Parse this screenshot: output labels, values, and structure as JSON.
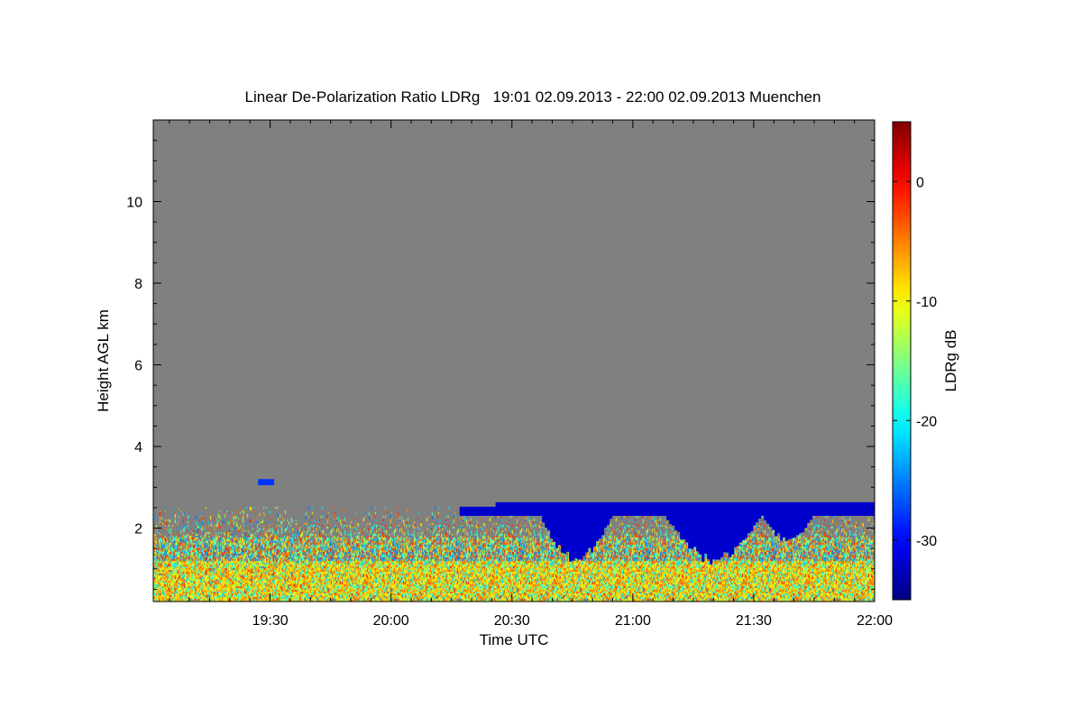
{
  "chart_data": {
    "type": "heatmap",
    "title": "Linear De-Polarization Ratio LDRg   19:01 02.09.2013 - 22:00 02.09.2013 Muenchen",
    "xlabel": "Time UTC",
    "ylabel": "Height AGL km",
    "colorbar_label": "LDRg dB",
    "x_unit": "UTC time",
    "xlim": [
      "19:01",
      "22:00"
    ],
    "ylim": [
      0.2,
      12.0
    ],
    "x_ticks": [
      "19:30",
      "20:00",
      "20:30",
      "21:00",
      "21:30",
      "22:00"
    ],
    "y_ticks": [
      2,
      4,
      6,
      8,
      10
    ],
    "colorbar_ticks": [
      0,
      -10,
      -20,
      -30
    ],
    "colorbar_range": [
      -35,
      5
    ],
    "colormap": "jet",
    "no_data_color": "#808080",
    "features": [
      {
        "name": "noisy aerosol boundary layer",
        "time_range": [
          "19:01",
          "22:00"
        ],
        "height_km": [
          0.2,
          2.5
        ],
        "ldr_db_range": [
          -25,
          0
        ]
      },
      {
        "name": "thin aerosol layer",
        "time_range": [
          "19:27",
          "19:31"
        ],
        "height_km": [
          3.05,
          3.2
        ],
        "ldr_db": -28
      },
      {
        "name": "low depolarization cloud layer with virga",
        "time_range": [
          "20:17",
          "22:00"
        ],
        "cloud_top_km": 2.7,
        "cloud_base_km": 2.3,
        "virga_lowest_km": 1.1,
        "ldr_db": -32
      }
    ]
  }
}
